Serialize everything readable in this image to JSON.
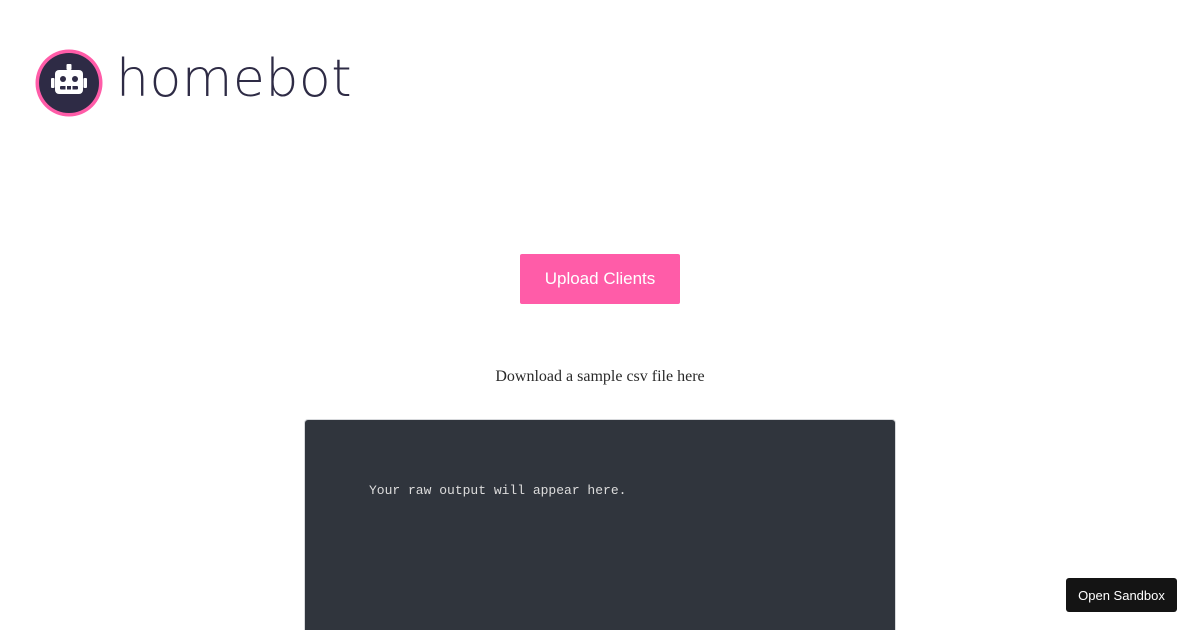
{
  "brand": {
    "name": "homebot",
    "logo_icon": "robot-icon",
    "colors": {
      "ring": "#ff5ca8",
      "disc": "#2e2b45",
      "robot": "#ffffff",
      "text": "#2e2b45"
    }
  },
  "main": {
    "upload_label": "Upload Clients",
    "upload_color": "#ff5ca8",
    "sample_link_text": "Download a sample csv file here"
  },
  "output": {
    "placeholder_text": "Your raw output will appear here.",
    "background_color": "#30353d"
  },
  "sandbox": {
    "label": "Open Sandbox"
  }
}
